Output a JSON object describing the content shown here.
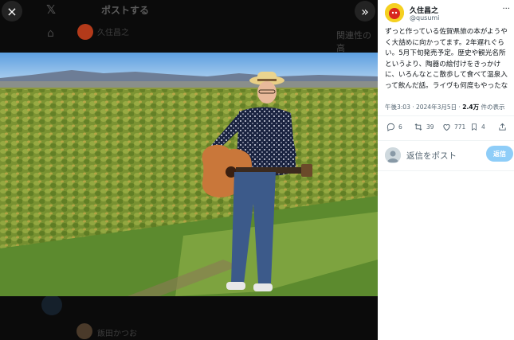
{
  "backdrop": {
    "header_title": "ポストする",
    "side_heading": "関連性の高",
    "author_partial": "久住昌之",
    "bottom_name": "飯田かつお"
  },
  "photo_viewer": {
    "close_glyph": "×",
    "expand_glyph": "»"
  },
  "tweet": {
    "author_name": "久住昌之",
    "author_handle": "@qusumi",
    "more_glyph": "···",
    "text": "ずっと作っている佐賀県旅の本がようやく大詰めに向かってます。2年遅れぐらい。5月下旬発売予定。歴史や観光名所というより、陶器の絵付けをきっかけに、いろんなとこ散歩して食べて温泉入って飲んだ話。ライヴも何度もやったな",
    "time_date": "午後3:03 · 2024年3月5日 · ",
    "views_count": "2.4万",
    "views_label": " 件の表示",
    "stats": {
      "replies": "6",
      "reposts": "39",
      "likes": "771",
      "bookmarks": "4"
    }
  },
  "reply_box": {
    "placeholder": "返信をポスト",
    "button_label": "返信"
  },
  "colors": {
    "accent": "#1d9bf0",
    "reply_button": "#8ecdf8",
    "panel_bg": "#ffffff",
    "overlay_bg": "#0b0b0b"
  }
}
